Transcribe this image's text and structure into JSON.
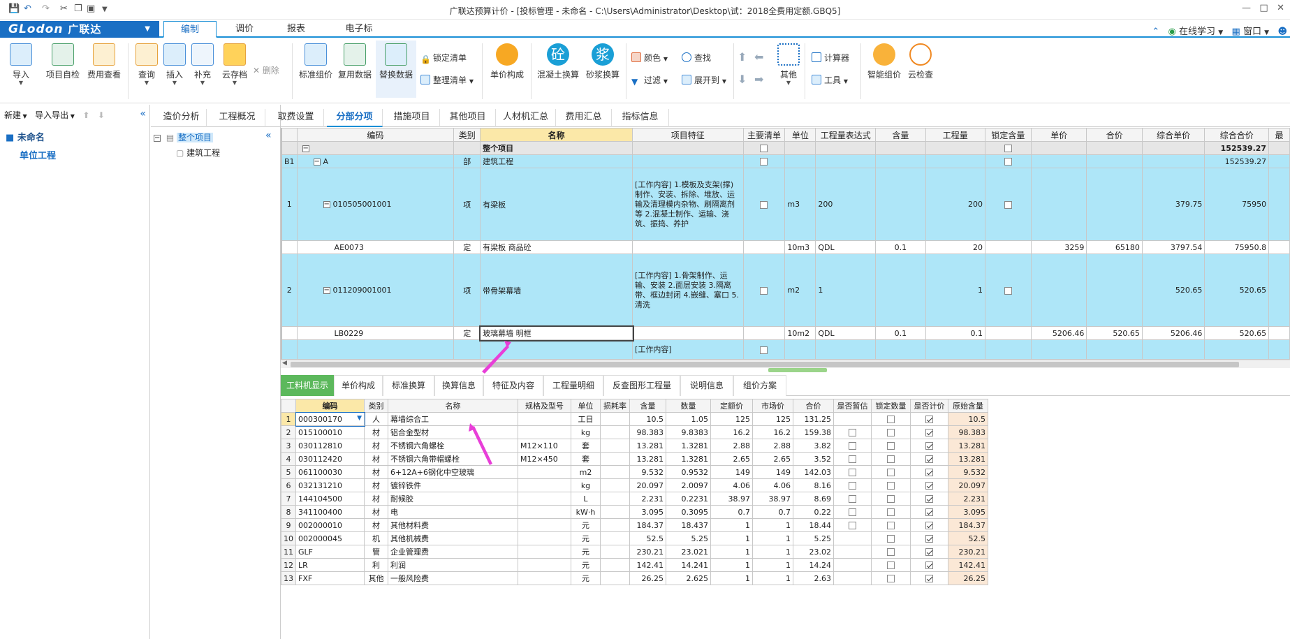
{
  "title": "广联达预算计价 - [投标管理 - 未命名 - C:\\Users\\Administrator\\Desktop\\试：2018全费用定额.GBQ5]",
  "menu": {
    "logo_en": "GLodon",
    "logo_cn": "广联达",
    "tabs": [
      "编制",
      "调价",
      "报表",
      "电子标"
    ],
    "online_learning": "在线学习",
    "window": "窗口"
  },
  "ribbon": {
    "import": "导入",
    "self_check": "项目自检",
    "fee_view": "费用查看",
    "query": "查询",
    "insert": "插入",
    "supplement": "补充",
    "cloud_save": "云存档",
    "delete": "删除",
    "std_price": "标准组价",
    "reuse_data": "复用数据",
    "replace_data": "替换数据",
    "lock_list": "锁定清单",
    "sort_list": "整理清单",
    "unit_price": "单价构成",
    "concrete": "混凝土换算",
    "mortar": "砂浆换算",
    "color": "颜色",
    "find": "查找",
    "filter": "过滤",
    "expand_to": "展开到",
    "other": "其他",
    "calculator": "计算器",
    "tools": "工具",
    "smart_price": "智能组价",
    "cloud_check": "云检查",
    "concrete_glyph": "砼",
    "mortar_glyph": "浆"
  },
  "left": {
    "new": "新建",
    "import_export": "导入导出",
    "project": "未命名",
    "unit": "单位工程"
  },
  "tree": {
    "root": "整个项目",
    "child": "建筑工程"
  },
  "main_tabs": [
    "造价分析",
    "工程概况",
    "取费设置",
    "分部分项",
    "措施项目",
    "其他项目",
    "人材机汇总",
    "费用汇总",
    "指标信息"
  ],
  "upper": {
    "headers": [
      "编码",
      "类别",
      "名称",
      "项目特征",
      "主要清单",
      "单位",
      "工程量表达式",
      "含量",
      "工程量",
      "锁定含量",
      "单价",
      "合价",
      "综合单价",
      "综合合价",
      "最"
    ],
    "rows": [
      {
        "seq": "",
        "code": "",
        "type": "",
        "name": "整个项目",
        "feat": "",
        "unit": "",
        "expr": "",
        "content": "",
        "qty": "",
        "price": "",
        "total": "",
        "comp_price": "",
        "comp_total": "152539.27"
      },
      {
        "seq": "B1",
        "code": "A",
        "type": "部",
        "name": "建筑工程",
        "feat": "",
        "unit": "",
        "expr": "",
        "content": "",
        "qty": "",
        "price": "",
        "total": "",
        "comp_price": "",
        "comp_total": "152539.27"
      },
      {
        "seq": "1",
        "code": "010505001001",
        "type": "项",
        "name": "有梁板",
        "feat": "[工作内容]\n1.模板及支架(撑)制作、安装、拆除、堆放、运输及清理模内杂物、刷隔离剂等\n2.混凝土制作、运输、浇筑、振捣、养护",
        "unit": "m3",
        "expr": "200",
        "content": "",
        "qty": "200",
        "price": "",
        "total": "",
        "comp_price": "379.75",
        "comp_total": "75950"
      },
      {
        "seq": "",
        "code": "AE0073",
        "type": "定",
        "name": "有梁板 商品砼",
        "feat": "",
        "unit": "10m3",
        "expr": "QDL",
        "content": "0.1",
        "qty": "20",
        "price": "3259",
        "total": "65180",
        "comp_price": "3797.54",
        "comp_total": "75950.8"
      },
      {
        "seq": "2",
        "code": "011209001001",
        "type": "项",
        "name": "带骨架幕墙",
        "feat": "[工作内容]\n1.骨架制作、运输、安装\n2.面层安装\n3.隔离带、框边封闭\n4.嵌缝、塞口\n5.清洗",
        "unit": "m2",
        "expr": "1",
        "content": "",
        "qty": "1",
        "price": "",
        "total": "",
        "comp_price": "520.65",
        "comp_total": "520.65"
      },
      {
        "seq": "",
        "code": "LB0229",
        "type": "定",
        "name": "玻璃幕墙 明框",
        "feat": "",
        "unit": "10m2",
        "expr": "QDL",
        "content": "0.1",
        "qty": "0.1",
        "price": "5206.46",
        "total": "520.65",
        "comp_price": "5206.46",
        "comp_total": "520.65"
      },
      {
        "seq": "",
        "code": "",
        "type": "",
        "name": "",
        "feat": "[工作内容]",
        "unit": "",
        "expr": "",
        "content": "",
        "qty": "",
        "price": "",
        "total": "",
        "comp_price": "",
        "comp_total": ""
      }
    ]
  },
  "lower_tabs": [
    "工料机显示",
    "单价构成",
    "标准换算",
    "换算信息",
    "特征及内容",
    "工程量明细",
    "反查图形工程量",
    "说明信息",
    "组价方案"
  ],
  "lower": {
    "headers": [
      "编码",
      "类别",
      "名称",
      "规格及型号",
      "单位",
      "损耗率",
      "含量",
      "数量",
      "定额价",
      "市场价",
      "合价",
      "是否暂估",
      "锁定数量",
      "是否计价",
      "原始含量"
    ],
    "rows": [
      {
        "no": "1",
        "code": "000300170",
        "type": "人",
        "name": "幕墙综合工",
        "spec": "",
        "unit": "工日",
        "loss": "",
        "content": "10.5",
        "qty": "1.05",
        "base": "125",
        "market": "125",
        "total": "131.25",
        "est": false,
        "lock": true,
        "priced": true,
        "orig": "10.5"
      },
      {
        "no": "2",
        "code": "015100010",
        "type": "材",
        "name": "铝合金型材",
        "spec": "",
        "unit": "kg",
        "loss": "",
        "content": "98.383",
        "qty": "9.8383",
        "base": "16.2",
        "market": "16.2",
        "total": "159.38",
        "est": true,
        "lock": true,
        "priced": true,
        "orig": "98.383"
      },
      {
        "no": "3",
        "code": "030112810",
        "type": "材",
        "name": "不锈钢六角螺栓",
        "spec": "M12×110",
        "unit": "套",
        "loss": "",
        "content": "13.281",
        "qty": "1.3281",
        "base": "2.88",
        "market": "2.88",
        "total": "3.82",
        "est": true,
        "lock": true,
        "priced": true,
        "orig": "13.281"
      },
      {
        "no": "4",
        "code": "030112420",
        "type": "材",
        "name": "不锈钢六角带帽螺栓",
        "spec": "M12×450",
        "unit": "套",
        "loss": "",
        "content": "13.281",
        "qty": "1.3281",
        "base": "2.65",
        "market": "2.65",
        "total": "3.52",
        "est": true,
        "lock": true,
        "priced": true,
        "orig": "13.281"
      },
      {
        "no": "5",
        "code": "061100030",
        "type": "材",
        "name": "6+12A+6钢化中空玻璃",
        "spec": "",
        "unit": "m2",
        "loss": "",
        "content": "9.532",
        "qty": "0.9532",
        "base": "149",
        "market": "149",
        "total": "142.03",
        "est": true,
        "lock": true,
        "priced": true,
        "orig": "9.532"
      },
      {
        "no": "6",
        "code": "032131210",
        "type": "材",
        "name": "镀锌铁件",
        "spec": "",
        "unit": "kg",
        "loss": "",
        "content": "20.097",
        "qty": "2.0097",
        "base": "4.06",
        "market": "4.06",
        "total": "8.16",
        "est": true,
        "lock": true,
        "priced": true,
        "orig": "20.097"
      },
      {
        "no": "7",
        "code": "144104500",
        "type": "材",
        "name": "耐候胶",
        "spec": "",
        "unit": "L",
        "loss": "",
        "content": "2.231",
        "qty": "0.2231",
        "base": "38.97",
        "market": "38.97",
        "total": "8.69",
        "est": true,
        "lock": true,
        "priced": true,
        "orig": "2.231"
      },
      {
        "no": "8",
        "code": "341100400",
        "type": "材",
        "name": "电",
        "spec": "",
        "unit": "kW·h",
        "loss": "",
        "content": "3.095",
        "qty": "0.3095",
        "base": "0.7",
        "market": "0.7",
        "total": "0.22",
        "est": true,
        "lock": true,
        "priced": true,
        "orig": "3.095"
      },
      {
        "no": "9",
        "code": "002000010",
        "type": "材",
        "name": "其他材料费",
        "spec": "",
        "unit": "元",
        "loss": "",
        "content": "184.37",
        "qty": "18.437",
        "base": "1",
        "market": "1",
        "total": "18.44",
        "est": true,
        "lock": true,
        "priced": true,
        "orig": "184.37"
      },
      {
        "no": "10",
        "code": "002000045",
        "type": "机",
        "name": "其他机械费",
        "spec": "",
        "unit": "元",
        "loss": "",
        "content": "52.5",
        "qty": "5.25",
        "base": "1",
        "market": "1",
        "total": "5.25",
        "est": false,
        "lock": true,
        "priced": true,
        "orig": "52.5"
      },
      {
        "no": "11",
        "code": "GLF",
        "type": "管",
        "name": "企业管理费",
        "spec": "",
        "unit": "元",
        "loss": "",
        "content": "230.21",
        "qty": "23.021",
        "base": "1",
        "market": "1",
        "total": "23.02",
        "est": false,
        "lock": true,
        "priced": true,
        "orig": "230.21"
      },
      {
        "no": "12",
        "code": "LR",
        "type": "利",
        "name": "利润",
        "spec": "",
        "unit": "元",
        "loss": "",
        "content": "142.41",
        "qty": "14.241",
        "base": "1",
        "market": "1",
        "total": "14.24",
        "est": false,
        "lock": true,
        "priced": true,
        "orig": "142.41"
      },
      {
        "no": "13",
        "code": "FXF",
        "type": "其他",
        "name": "一般风险费",
        "spec": "",
        "unit": "元",
        "loss": "",
        "content": "26.25",
        "qty": "2.625",
        "base": "1",
        "market": "1",
        "total": "2.63",
        "est": false,
        "lock": true,
        "priced": true,
        "orig": "26.25"
      }
    ]
  },
  "colors": {
    "accent": "#1a6fc4",
    "row_blue": "#aee6f8",
    "row_grey": "#e6e6e6",
    "tab_green": "#5cb85c",
    "arrow": "#e83fd8"
  }
}
